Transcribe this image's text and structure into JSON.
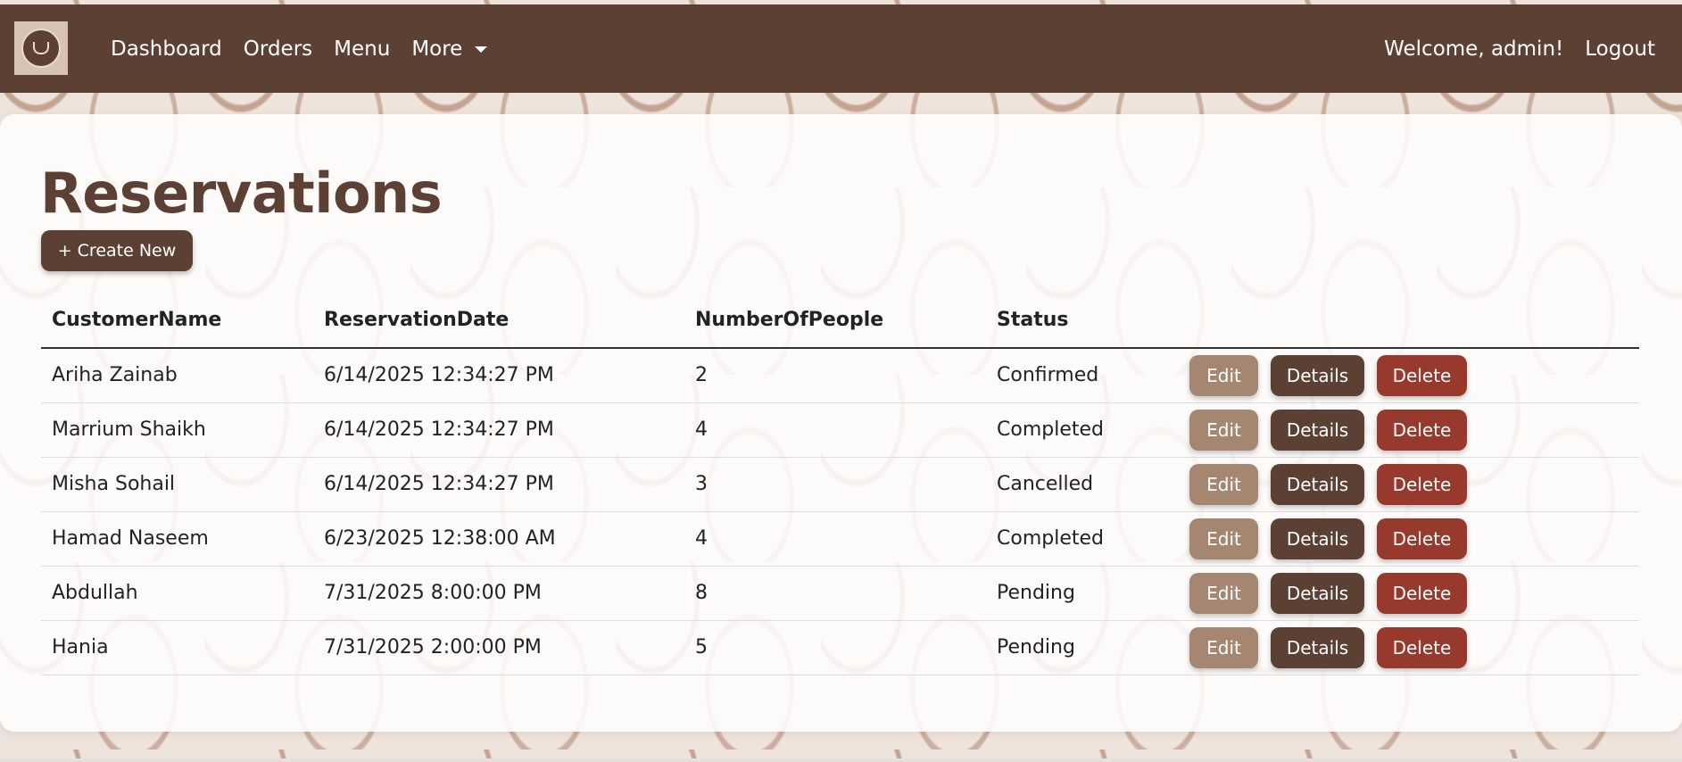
{
  "nav": {
    "logo_icon": "coffee-cup-icon",
    "links": [
      "Dashboard",
      "Orders",
      "Menu",
      "More"
    ],
    "welcome": "Welcome, admin!",
    "logout": "Logout"
  },
  "page": {
    "title": "Reservations",
    "create_label": "+ Create New"
  },
  "table": {
    "headers": [
      "CustomerName",
      "ReservationDate",
      "NumberOfPeople",
      "Status"
    ],
    "rows": [
      {
        "name": "Ariha Zainab",
        "date": "6/14/2025 12:34:27 PM",
        "people": "2",
        "status": "Confirmed"
      },
      {
        "name": "Marrium Shaikh",
        "date": "6/14/2025 12:34:27 PM",
        "people": "4",
        "status": "Completed"
      },
      {
        "name": "Misha Sohail",
        "date": "6/14/2025 12:34:27 PM",
        "people": "3",
        "status": "Cancelled"
      },
      {
        "name": "Hamad Naseem",
        "date": "6/23/2025 12:38:00 AM",
        "people": "4",
        "status": "Completed"
      },
      {
        "name": "Abdullah",
        "date": "7/31/2025 8:00:00 PM",
        "people": "8",
        "status": "Pending"
      },
      {
        "name": "Hania",
        "date": "7/31/2025 2:00:00 PM",
        "people": "5",
        "status": "Pending"
      }
    ],
    "actions": {
      "edit": "Edit",
      "details": "Details",
      "delete": "Delete"
    }
  },
  "colors": {
    "navbar": "#5d4034",
    "edit": "#a48671",
    "details": "#5d4034",
    "delete": "#973a2d"
  }
}
